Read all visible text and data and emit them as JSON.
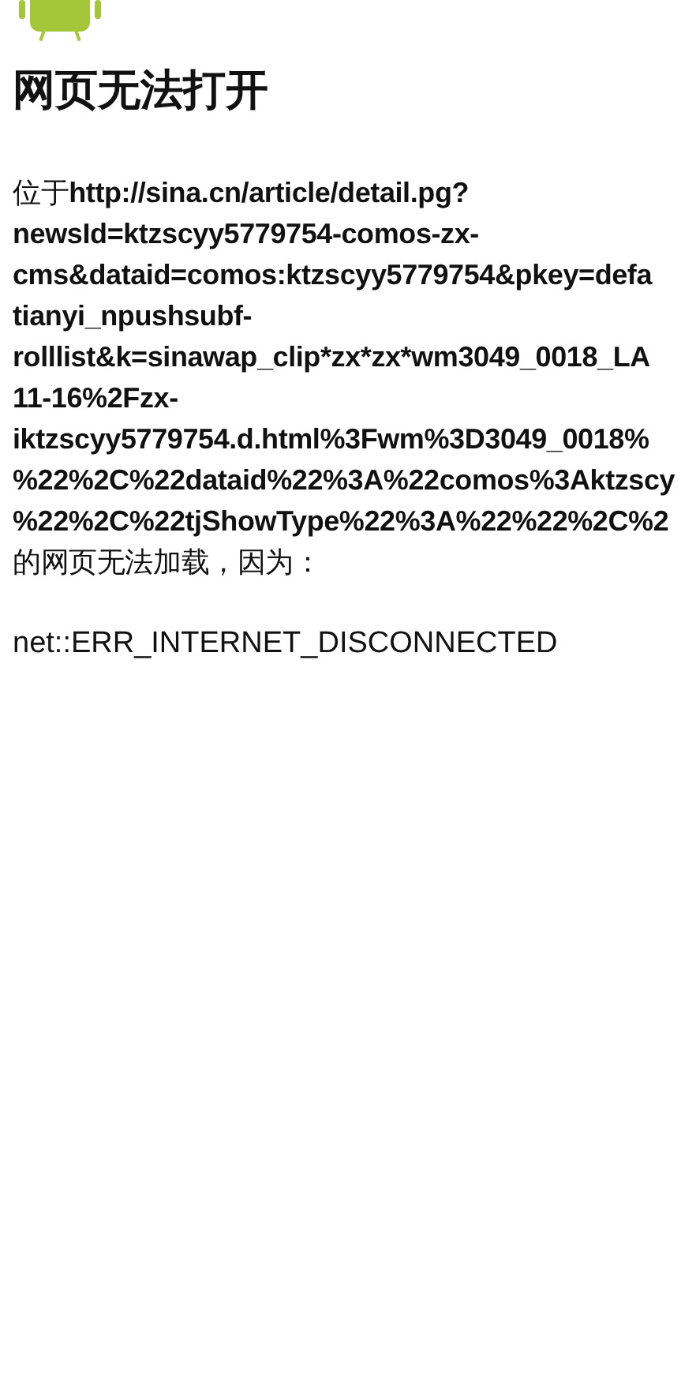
{
  "title": "网页无法打开",
  "description": {
    "prefix": "位于",
    "url_lines": [
      "http://sina.cn/article/detail.pg?",
      "newsId=ktzscyy5779754-comos-zx-",
      "cms&dataid=comos:ktzscyy5779754&pkey=defa",
      "tianyi_npushsubf-",
      "rolllist&k=sinawap_clip*zx*zx*wm3049_0018_LA",
      "11-16%2Fzx-",
      "iktzscyy5779754.d.html%3Fwm%3D3049_0018%",
      "%22%2C%22dataid%22%3A%22comos%3Aktzscy",
      "%22%2C%22tjShowType%22%3A%22%22%2C%2"
    ],
    "suffix": "的网页无法加载，因为："
  },
  "error_code": "net::ERR_INTERNET_DISCONNECTED"
}
